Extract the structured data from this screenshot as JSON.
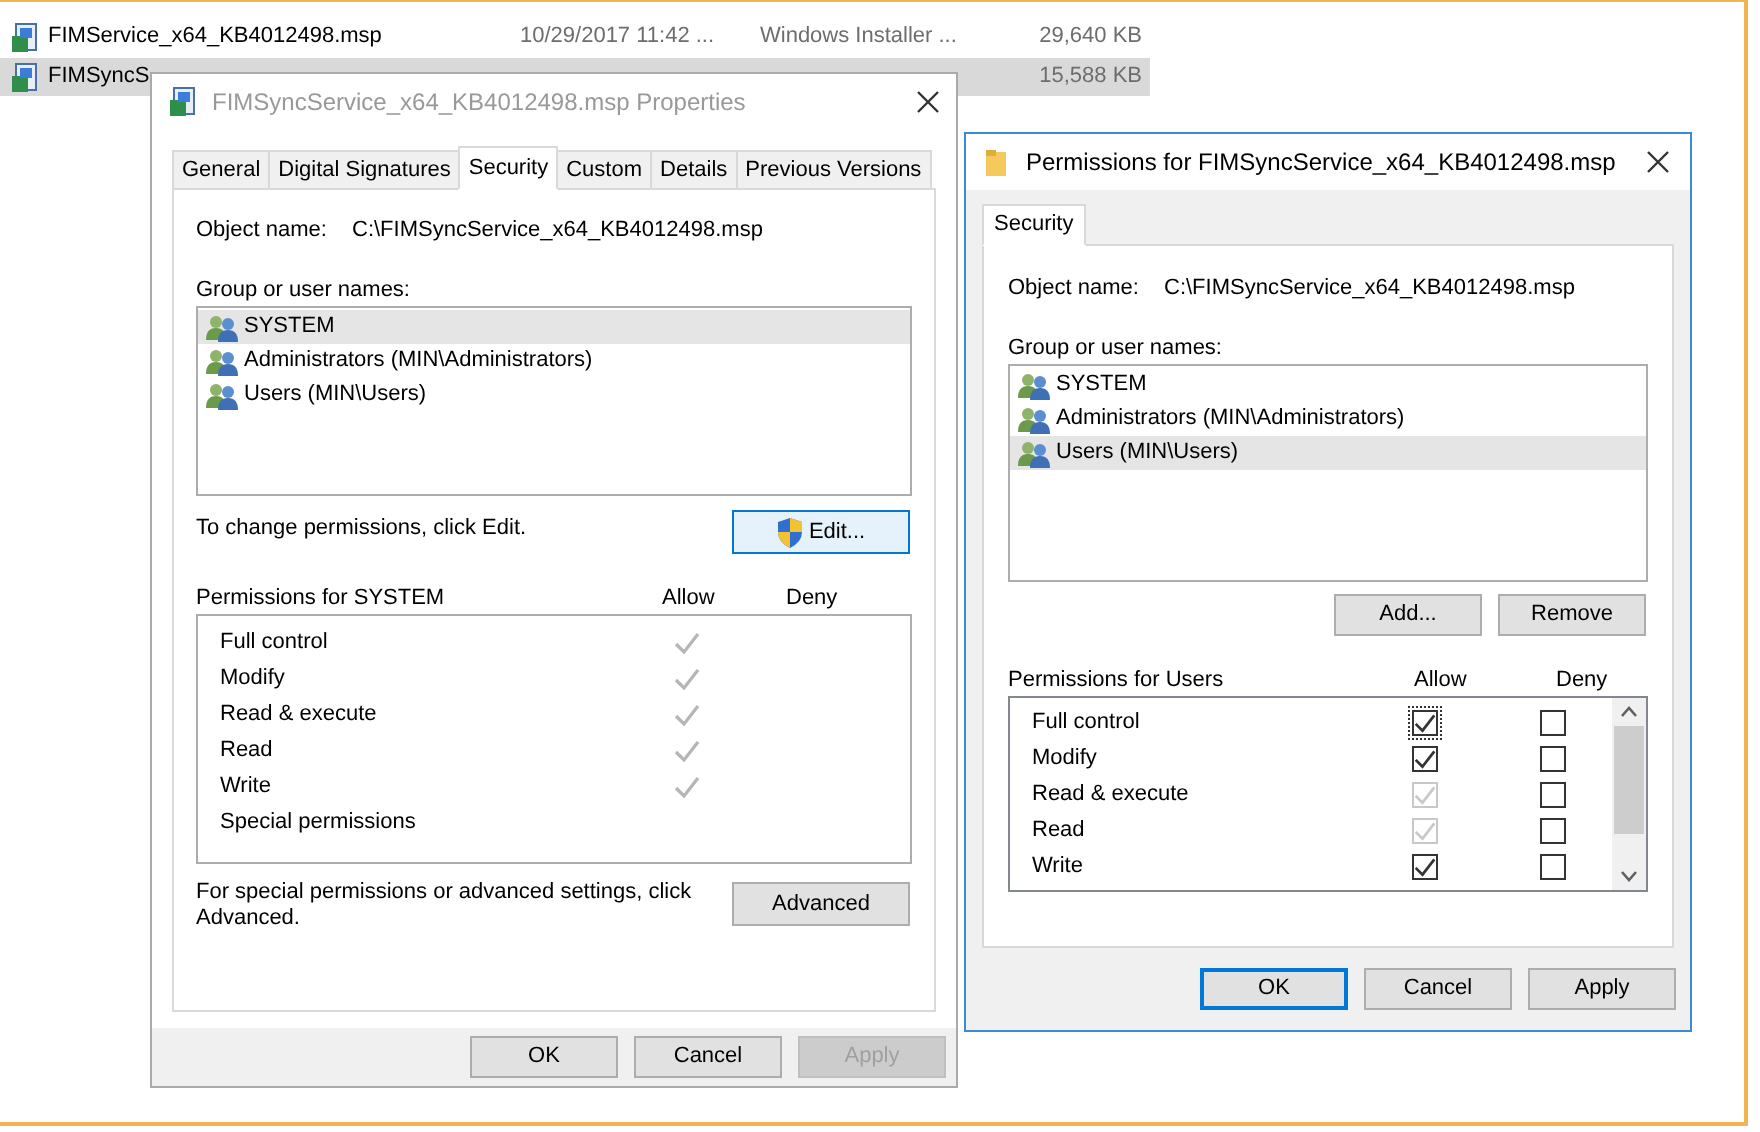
{
  "explorer": {
    "files": [
      {
        "name": "FIMService_x64_KB4012498.msp",
        "date": "10/29/2017 11:42 ...",
        "type": "Windows Installer ...",
        "size": "29,640 KB",
        "selected": false
      },
      {
        "name": "FIMSyncS",
        "size": "15,588 KB",
        "selected": true
      }
    ]
  },
  "properties_dialog": {
    "title": "FIMSyncService_x64_KB4012498.msp Properties",
    "tabs": [
      {
        "label": "General",
        "selected": false
      },
      {
        "label": "Digital Signatures",
        "selected": false
      },
      {
        "label": "Security",
        "selected": true
      },
      {
        "label": "Custom",
        "selected": false
      },
      {
        "label": "Details",
        "selected": false
      },
      {
        "label": "Previous Versions",
        "selected": false
      }
    ],
    "object_label": "Object name:",
    "object_name": "C:\\FIMSyncService_x64_KB4012498.msp",
    "group_label": "Group or user names:",
    "users": [
      {
        "name": "SYSTEM",
        "selected": true
      },
      {
        "name": "Administrators (MIN\\Administrators)",
        "selected": false
      },
      {
        "name": "Users (MIN\\Users)",
        "selected": false
      }
    ],
    "change_hint": "To change permissions, click Edit.",
    "edit_button": "Edit...",
    "permissions_label": "Permissions for SYSTEM",
    "allow_header": "Allow",
    "deny_header": "Deny",
    "permissions": [
      {
        "name": "Full control",
        "allow": true,
        "deny": false
      },
      {
        "name": "Modify",
        "allow": true,
        "deny": false
      },
      {
        "name": "Read & execute",
        "allow": true,
        "deny": false
      },
      {
        "name": "Read",
        "allow": true,
        "deny": false
      },
      {
        "name": "Write",
        "allow": true,
        "deny": false
      },
      {
        "name": "Special permissions",
        "allow": false,
        "deny": false
      }
    ],
    "advanced_hint": "For special permissions or advanced settings, click Advanced.",
    "advanced_button": "Advanced",
    "buttons": [
      {
        "label": "OK",
        "disabled": false
      },
      {
        "label": "Cancel",
        "disabled": false
      },
      {
        "label": "Apply",
        "disabled": true
      }
    ]
  },
  "permissions_dialog": {
    "title": "Permissions for FIMSyncService_x64_KB4012498.msp",
    "tabs": [
      {
        "label": "Security",
        "selected": true
      }
    ],
    "object_label": "Object name:",
    "object_name": "C:\\FIMSyncService_x64_KB4012498.msp",
    "group_label": "Group or user names:",
    "users": [
      {
        "name": "SYSTEM",
        "selected": false
      },
      {
        "name": "Administrators (MIN\\Administrators)",
        "selected": false
      },
      {
        "name": "Users (MIN\\Users)",
        "selected": true
      }
    ],
    "add_button": "Add...",
    "remove_button": "Remove",
    "permissions_label": "Permissions for Users",
    "allow_header": "Allow",
    "deny_header": "Deny",
    "permissions": [
      {
        "name": "Full control",
        "allow": true,
        "allow_disabled": false,
        "focused": true,
        "deny": false
      },
      {
        "name": "Modify",
        "allow": true,
        "allow_disabled": false,
        "focused": false,
        "deny": false
      },
      {
        "name": "Read & execute",
        "allow": true,
        "allow_disabled": true,
        "focused": false,
        "deny": false
      },
      {
        "name": "Read",
        "allow": true,
        "allow_disabled": true,
        "focused": false,
        "deny": false
      },
      {
        "name": "Write",
        "allow": true,
        "allow_disabled": false,
        "focused": false,
        "deny": false
      }
    ],
    "buttons": [
      {
        "label": "OK",
        "default": true
      },
      {
        "label": "Cancel",
        "default": false
      },
      {
        "label": "Apply",
        "default": false
      }
    ]
  }
}
